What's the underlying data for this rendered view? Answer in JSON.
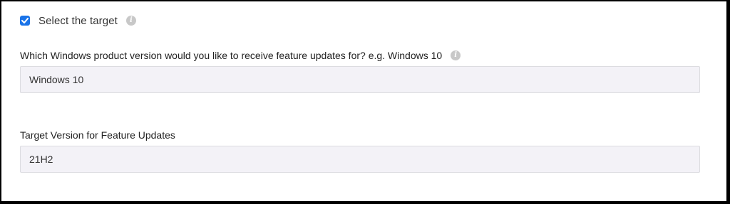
{
  "target_checkbox": {
    "label": "Select the target",
    "checked": true,
    "info_icon": "info-icon"
  },
  "product_version": {
    "label": "Which Windows product version would you like to receive feature updates for? e.g. Windows 10",
    "value": "Windows 10",
    "info_icon": "info-icon"
  },
  "target_version": {
    "label": "Target Version for Feature Updates",
    "value": "21H2"
  },
  "colors": {
    "checkbox_accent": "#1a73e8",
    "input_background": "#f3f2f7",
    "info_icon": "#c8c8c8",
    "frame_border": "#000000"
  }
}
